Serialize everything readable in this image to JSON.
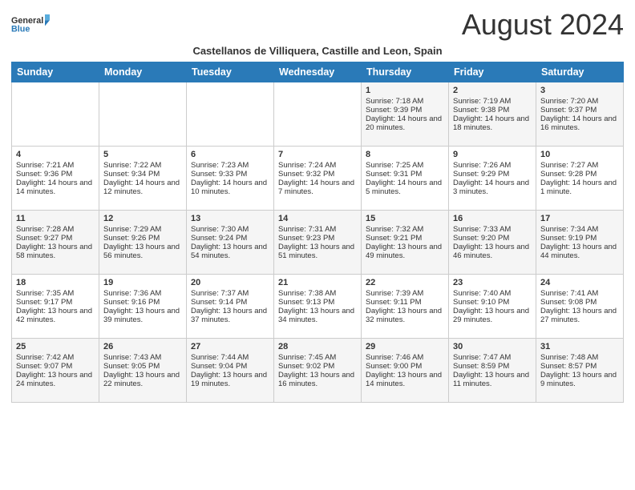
{
  "logo": {
    "line1": "General",
    "line2": "Blue"
  },
  "title": "August 2024",
  "subtitle": "Castellanos de Villiquera, Castille and Leon, Spain",
  "headers": [
    "Sunday",
    "Monday",
    "Tuesday",
    "Wednesday",
    "Thursday",
    "Friday",
    "Saturday"
  ],
  "weeks": [
    [
      {
        "day": "",
        "info": ""
      },
      {
        "day": "",
        "info": ""
      },
      {
        "day": "",
        "info": ""
      },
      {
        "day": "",
        "info": ""
      },
      {
        "day": "1",
        "info": "Sunrise: 7:18 AM\nSunset: 9:39 PM\nDaylight: 14 hours and 20 minutes."
      },
      {
        "day": "2",
        "info": "Sunrise: 7:19 AM\nSunset: 9:38 PM\nDaylight: 14 hours and 18 minutes."
      },
      {
        "day": "3",
        "info": "Sunrise: 7:20 AM\nSunset: 9:37 PM\nDaylight: 14 hours and 16 minutes."
      }
    ],
    [
      {
        "day": "4",
        "info": "Sunrise: 7:21 AM\nSunset: 9:36 PM\nDaylight: 14 hours and 14 minutes."
      },
      {
        "day": "5",
        "info": "Sunrise: 7:22 AM\nSunset: 9:34 PM\nDaylight: 14 hours and 12 minutes."
      },
      {
        "day": "6",
        "info": "Sunrise: 7:23 AM\nSunset: 9:33 PM\nDaylight: 14 hours and 10 minutes."
      },
      {
        "day": "7",
        "info": "Sunrise: 7:24 AM\nSunset: 9:32 PM\nDaylight: 14 hours and 7 minutes."
      },
      {
        "day": "8",
        "info": "Sunrise: 7:25 AM\nSunset: 9:31 PM\nDaylight: 14 hours and 5 minutes."
      },
      {
        "day": "9",
        "info": "Sunrise: 7:26 AM\nSunset: 9:29 PM\nDaylight: 14 hours and 3 minutes."
      },
      {
        "day": "10",
        "info": "Sunrise: 7:27 AM\nSunset: 9:28 PM\nDaylight: 14 hours and 1 minute."
      }
    ],
    [
      {
        "day": "11",
        "info": "Sunrise: 7:28 AM\nSunset: 9:27 PM\nDaylight: 13 hours and 58 minutes."
      },
      {
        "day": "12",
        "info": "Sunrise: 7:29 AM\nSunset: 9:26 PM\nDaylight: 13 hours and 56 minutes."
      },
      {
        "day": "13",
        "info": "Sunrise: 7:30 AM\nSunset: 9:24 PM\nDaylight: 13 hours and 54 minutes."
      },
      {
        "day": "14",
        "info": "Sunrise: 7:31 AM\nSunset: 9:23 PM\nDaylight: 13 hours and 51 minutes."
      },
      {
        "day": "15",
        "info": "Sunrise: 7:32 AM\nSunset: 9:21 PM\nDaylight: 13 hours and 49 minutes."
      },
      {
        "day": "16",
        "info": "Sunrise: 7:33 AM\nSunset: 9:20 PM\nDaylight: 13 hours and 46 minutes."
      },
      {
        "day": "17",
        "info": "Sunrise: 7:34 AM\nSunset: 9:19 PM\nDaylight: 13 hours and 44 minutes."
      }
    ],
    [
      {
        "day": "18",
        "info": "Sunrise: 7:35 AM\nSunset: 9:17 PM\nDaylight: 13 hours and 42 minutes."
      },
      {
        "day": "19",
        "info": "Sunrise: 7:36 AM\nSunset: 9:16 PM\nDaylight: 13 hours and 39 minutes."
      },
      {
        "day": "20",
        "info": "Sunrise: 7:37 AM\nSunset: 9:14 PM\nDaylight: 13 hours and 37 minutes."
      },
      {
        "day": "21",
        "info": "Sunrise: 7:38 AM\nSunset: 9:13 PM\nDaylight: 13 hours and 34 minutes."
      },
      {
        "day": "22",
        "info": "Sunrise: 7:39 AM\nSunset: 9:11 PM\nDaylight: 13 hours and 32 minutes."
      },
      {
        "day": "23",
        "info": "Sunrise: 7:40 AM\nSunset: 9:10 PM\nDaylight: 13 hours and 29 minutes."
      },
      {
        "day": "24",
        "info": "Sunrise: 7:41 AM\nSunset: 9:08 PM\nDaylight: 13 hours and 27 minutes."
      }
    ],
    [
      {
        "day": "25",
        "info": "Sunrise: 7:42 AM\nSunset: 9:07 PM\nDaylight: 13 hours and 24 minutes."
      },
      {
        "day": "26",
        "info": "Sunrise: 7:43 AM\nSunset: 9:05 PM\nDaylight: 13 hours and 22 minutes."
      },
      {
        "day": "27",
        "info": "Sunrise: 7:44 AM\nSunset: 9:04 PM\nDaylight: 13 hours and 19 minutes."
      },
      {
        "day": "28",
        "info": "Sunrise: 7:45 AM\nSunset: 9:02 PM\nDaylight: 13 hours and 16 minutes."
      },
      {
        "day": "29",
        "info": "Sunrise: 7:46 AM\nSunset: 9:00 PM\nDaylight: 13 hours and 14 minutes."
      },
      {
        "day": "30",
        "info": "Sunrise: 7:47 AM\nSunset: 8:59 PM\nDaylight: 13 hours and 11 minutes."
      },
      {
        "day": "31",
        "info": "Sunrise: 7:48 AM\nSunset: 8:57 PM\nDaylight: 13 hours and 9 minutes."
      }
    ]
  ],
  "colors": {
    "header_bg": "#2a7ab8",
    "header_text": "#ffffff",
    "odd_row": "#f5f5f5",
    "even_row": "#ffffff"
  }
}
